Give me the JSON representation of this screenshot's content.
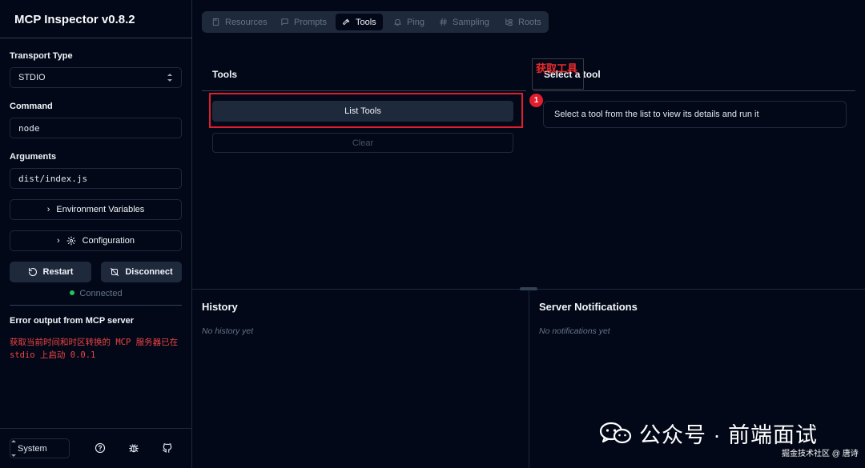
{
  "app": {
    "title": "MCP Inspector v0.8.2"
  },
  "sidebar": {
    "transport_label": "Transport Type",
    "transport_value": "STDIO",
    "command_label": "Command",
    "command_value": "node",
    "arguments_label": "Arguments",
    "arguments_value": "dist/index.js",
    "env_button": "Environment Variables",
    "config_button": "Configuration",
    "restart_button": "Restart",
    "disconnect_button": "Disconnect",
    "status_text": "Connected",
    "error_title": "Error output from MCP server",
    "error_text": "获取当前时间和时区转换的 MCP 服务器已在 stdio 上启动 0.0.1",
    "theme_value": "System"
  },
  "tabs": [
    {
      "label": "Resources",
      "icon": "file-icon",
      "active": false
    },
    {
      "label": "Prompts",
      "icon": "message-icon",
      "active": false
    },
    {
      "label": "Tools",
      "icon": "hammer-icon",
      "active": true
    },
    {
      "label": "Ping",
      "icon": "bell-icon",
      "active": false
    },
    {
      "label": "Sampling",
      "icon": "hash-icon",
      "active": false
    },
    {
      "label": "Roots",
      "icon": "folder-tree-icon",
      "active": false
    }
  ],
  "tools_panel": {
    "title": "Tools",
    "list_button": "List Tools",
    "clear_button": "Clear"
  },
  "detail_panel": {
    "title": "Select a tool",
    "placeholder": "Select a tool from the list to view its details and run it"
  },
  "annotation": {
    "label": "获取工具",
    "badge": "1",
    "color": "#e11d2e"
  },
  "history": {
    "title": "History",
    "empty": "No history yet"
  },
  "notifications": {
    "title": "Server Notifications",
    "empty": "No notifications yet"
  },
  "watermark": {
    "text": "公众号 · 前端面试",
    "credit": "掘金技术社区 @ 唐诗"
  },
  "colors": {
    "background": "#020817",
    "surface": "#1e293b",
    "border": "#334155",
    "status_ok": "#22c55e",
    "error": "#ef4444"
  }
}
